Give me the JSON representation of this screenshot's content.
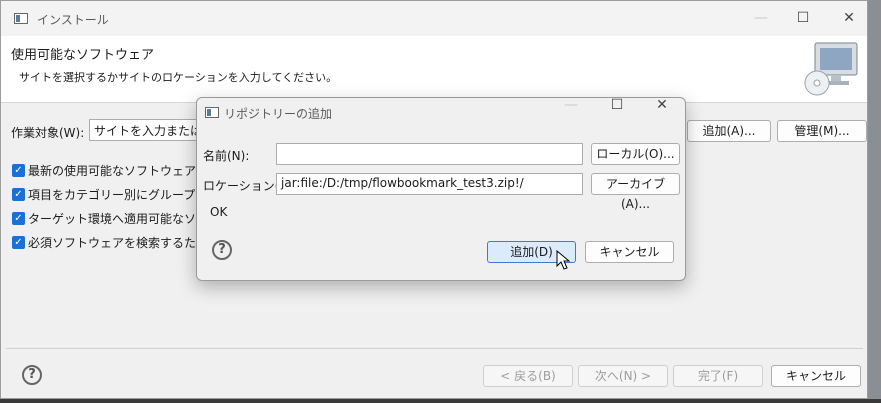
{
  "main_window": {
    "title": "インストール",
    "controls": {
      "minimize": "—",
      "maximize": "☐",
      "close": "✕"
    },
    "banner": {
      "heading": "使用可能なソフトウェア",
      "description": "サイトを選択するかサイトのロケーションを入力してください。"
    },
    "work_with": {
      "label": "作業対象(W):",
      "value": "サイトを入力または選択",
      "add_button": "追加(A)...",
      "manage_button": "管理(M)..."
    },
    "options": [
      {
        "label": "最新の使用可能なソフトウェア・バージョンのみ表示",
        "checked": true
      },
      {
        "label": "項目をカテゴリー別にグループ化(G)",
        "checked": true
      },
      {
        "label": "ターゲット環境へ適用可能なソフトウェアのみ表示",
        "checked": true
      },
      {
        "label": "必須ソフトウェアを検索するためにインストール中にすべての更新サイトに接続",
        "checked": true
      }
    ],
    "footer": {
      "help": "?",
      "back_button": "< 戻る(B)",
      "next_button": "次へ(N) >",
      "finish_button": "完了(F)",
      "cancel_button": "キャンセル"
    }
  },
  "dialog": {
    "title": "リポジトリーの追加",
    "controls": {
      "minimize": "—",
      "maximize": "☐",
      "close": "✕"
    },
    "name_label": "名前(N):",
    "name_value": "",
    "local_button": "ローカル(O)...",
    "location_label": "ロケーション(L):",
    "location_value": "jar:file:/D:/tmp/flowbookmark_test3.zip!/",
    "archive_button": "アーカイブ(A)...",
    "status": "OK",
    "help": "?",
    "add_button": "追加(D)",
    "cancel_button": "キャンセル"
  }
}
